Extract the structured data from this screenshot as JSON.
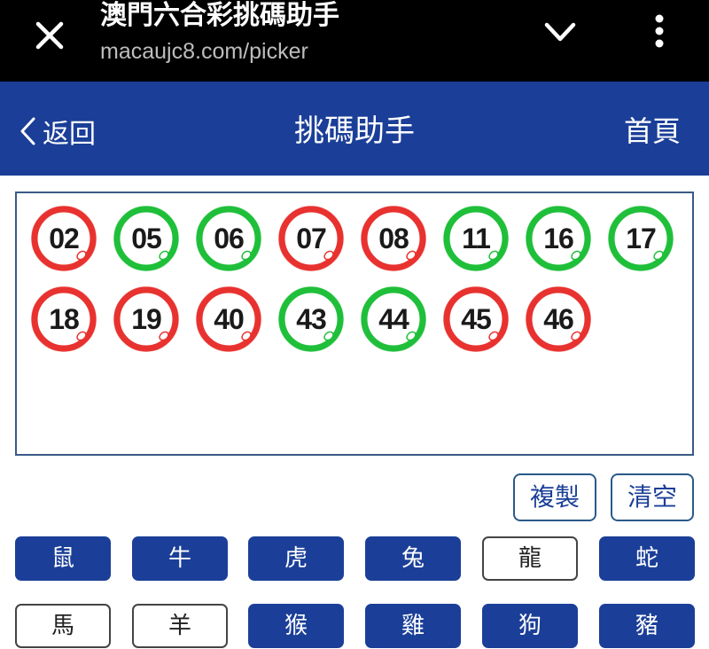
{
  "browser": {
    "title": "澳門六合彩挑碼助手",
    "url": "macaujc8.com/picker"
  },
  "header": {
    "back_label": "返回",
    "title": "挑碼助手",
    "home_label": "首頁"
  },
  "balls": [
    {
      "num": "02",
      "color": "red"
    },
    {
      "num": "05",
      "color": "green"
    },
    {
      "num": "06",
      "color": "green"
    },
    {
      "num": "07",
      "color": "red"
    },
    {
      "num": "08",
      "color": "red"
    },
    {
      "num": "11",
      "color": "green"
    },
    {
      "num": "16",
      "color": "green"
    },
    {
      "num": "17",
      "color": "green"
    },
    {
      "num": "18",
      "color": "red"
    },
    {
      "num": "19",
      "color": "red"
    },
    {
      "num": "40",
      "color": "red"
    },
    {
      "num": "43",
      "color": "green"
    },
    {
      "num": "44",
      "color": "green"
    },
    {
      "num": "45",
      "color": "red"
    },
    {
      "num": "46",
      "color": "red"
    }
  ],
  "actions": {
    "copy_label": "複製",
    "clear_label": "清空"
  },
  "zodiac": [
    {
      "label": "鼠",
      "selected": true
    },
    {
      "label": "牛",
      "selected": true
    },
    {
      "label": "虎",
      "selected": true
    },
    {
      "label": "兔",
      "selected": true
    },
    {
      "label": "龍",
      "selected": false
    },
    {
      "label": "蛇",
      "selected": true
    },
    {
      "label": "馬",
      "selected": false
    },
    {
      "label": "羊",
      "selected": false
    },
    {
      "label": "猴",
      "selected": true
    },
    {
      "label": "雞",
      "selected": true
    },
    {
      "label": "狗",
      "selected": true
    },
    {
      "label": "豬",
      "selected": true
    }
  ],
  "colors": {
    "brand_blue": "#1b3f98",
    "ball_red": "#e8322f",
    "ball_green": "#1fbf3a"
  }
}
